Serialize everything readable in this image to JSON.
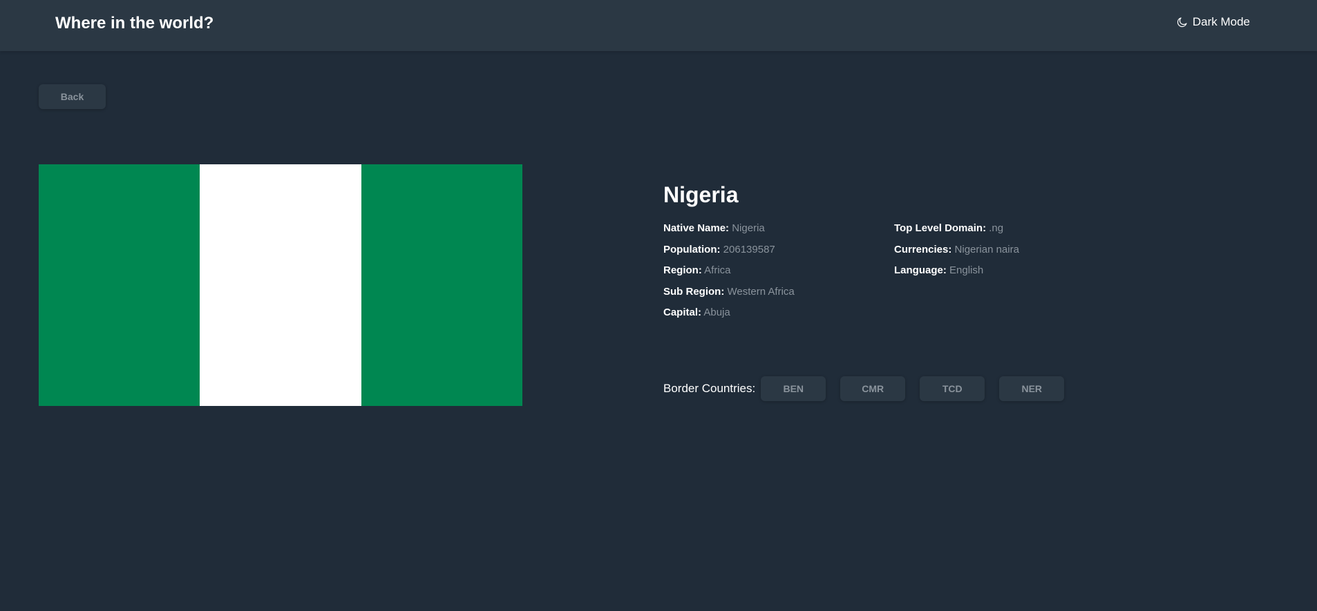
{
  "header": {
    "title": "Where in the world?",
    "mode_toggle": {
      "icon": "moon-icon",
      "label": "Dark Mode"
    }
  },
  "back_button": {
    "label": "Back"
  },
  "flag": {
    "country": "Nigeria",
    "bands": [
      "#008751",
      "#ffffff",
      "#008751"
    ]
  },
  "country": {
    "name": "Nigeria",
    "details_left": [
      {
        "label": "Native Name:",
        "value": "Nigeria"
      },
      {
        "label": "Population:",
        "value": "206139587"
      },
      {
        "label": "Region:",
        "value": "Africa"
      },
      {
        "label": "Sub Region:",
        "value": "Western Africa"
      },
      {
        "label": "Capital:",
        "value": "Abuja"
      }
    ],
    "details_right": [
      {
        "label": "Top Level Domain:",
        "value": ".ng"
      },
      {
        "label": "Currencies:",
        "value": "Nigerian naira"
      },
      {
        "label": "Language:",
        "value": "English"
      }
    ],
    "border_label": "Border Countries:",
    "borders": [
      "BEN",
      "CMR",
      "TCD",
      "NER"
    ]
  },
  "colors": {
    "background": "#202c39",
    "surface": "#2b3844",
    "text": "#ffffff",
    "muted_text": "#8a939c"
  }
}
